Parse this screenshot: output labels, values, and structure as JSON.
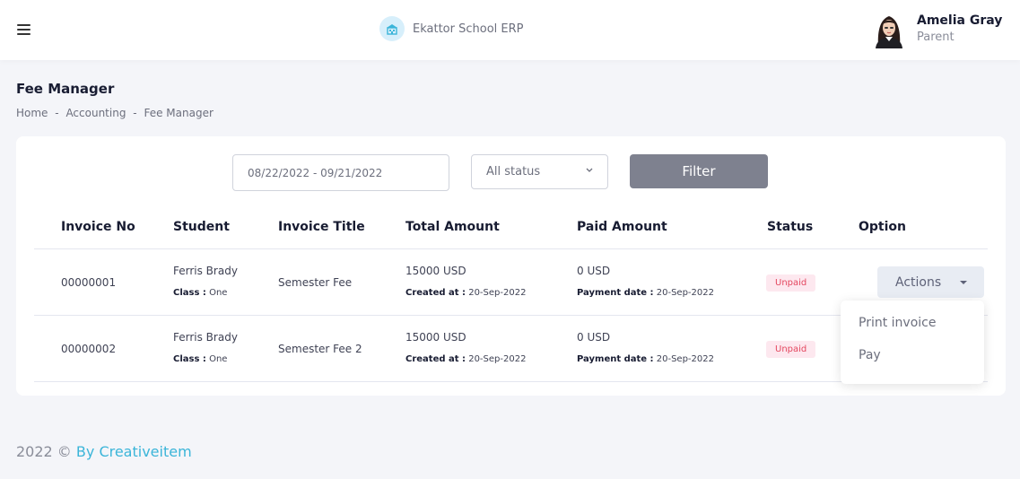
{
  "app": {
    "brand_name": "Ekattor School ERP",
    "user_name": "Amelia Gray",
    "user_role": "Parent"
  },
  "page": {
    "title": "Fee Manager",
    "breadcrumb": [
      "Home",
      "Accounting",
      "Fee Manager"
    ],
    "breadcrumb_separator": "-"
  },
  "filters": {
    "date_range": "08/22/2022 - 09/21/2022",
    "status_value": "All status",
    "filter_label": "Filter"
  },
  "table": {
    "headers": [
      "Invoice No",
      "Student",
      "Invoice Title",
      "Total Amount",
      "Paid Amount",
      "Status",
      "Option"
    ],
    "class_label": "Class :",
    "created_label": "Created at :",
    "payment_date_label": "Payment date :",
    "rows": [
      {
        "invoice_no": "00000001",
        "student": "Ferris Brady",
        "class": "One",
        "title": "Semester Fee",
        "total": "15000 USD",
        "created_at": "20-Sep-2022",
        "paid": "0 USD",
        "payment_date": "20-Sep-2022",
        "status": "Unpaid"
      },
      {
        "invoice_no": "00000002",
        "student": "Ferris Brady",
        "class": "One",
        "title": "Semester Fee 2",
        "total": "15000 USD",
        "created_at": "20-Sep-2022",
        "paid": "0 USD",
        "payment_date": "20-Sep-2022",
        "status": "Unpaid"
      }
    ]
  },
  "actions": {
    "button_label": "Actions",
    "menu": [
      "Print invoice",
      "Pay"
    ]
  },
  "footer": {
    "year": "2022 ©",
    "link_text": "By Creativeitem"
  },
  "colors": {
    "accent": "#3bb5d9",
    "filter_button": "#7e818f",
    "unpaid_badge_bg": "#fde8ef",
    "unpaid_badge_text": "#e4475f"
  },
  "icons": {
    "menu": "hamburger-icon",
    "brand": "school-icon",
    "select": "chevron-down-icon",
    "actions": "caret-down-icon"
  }
}
